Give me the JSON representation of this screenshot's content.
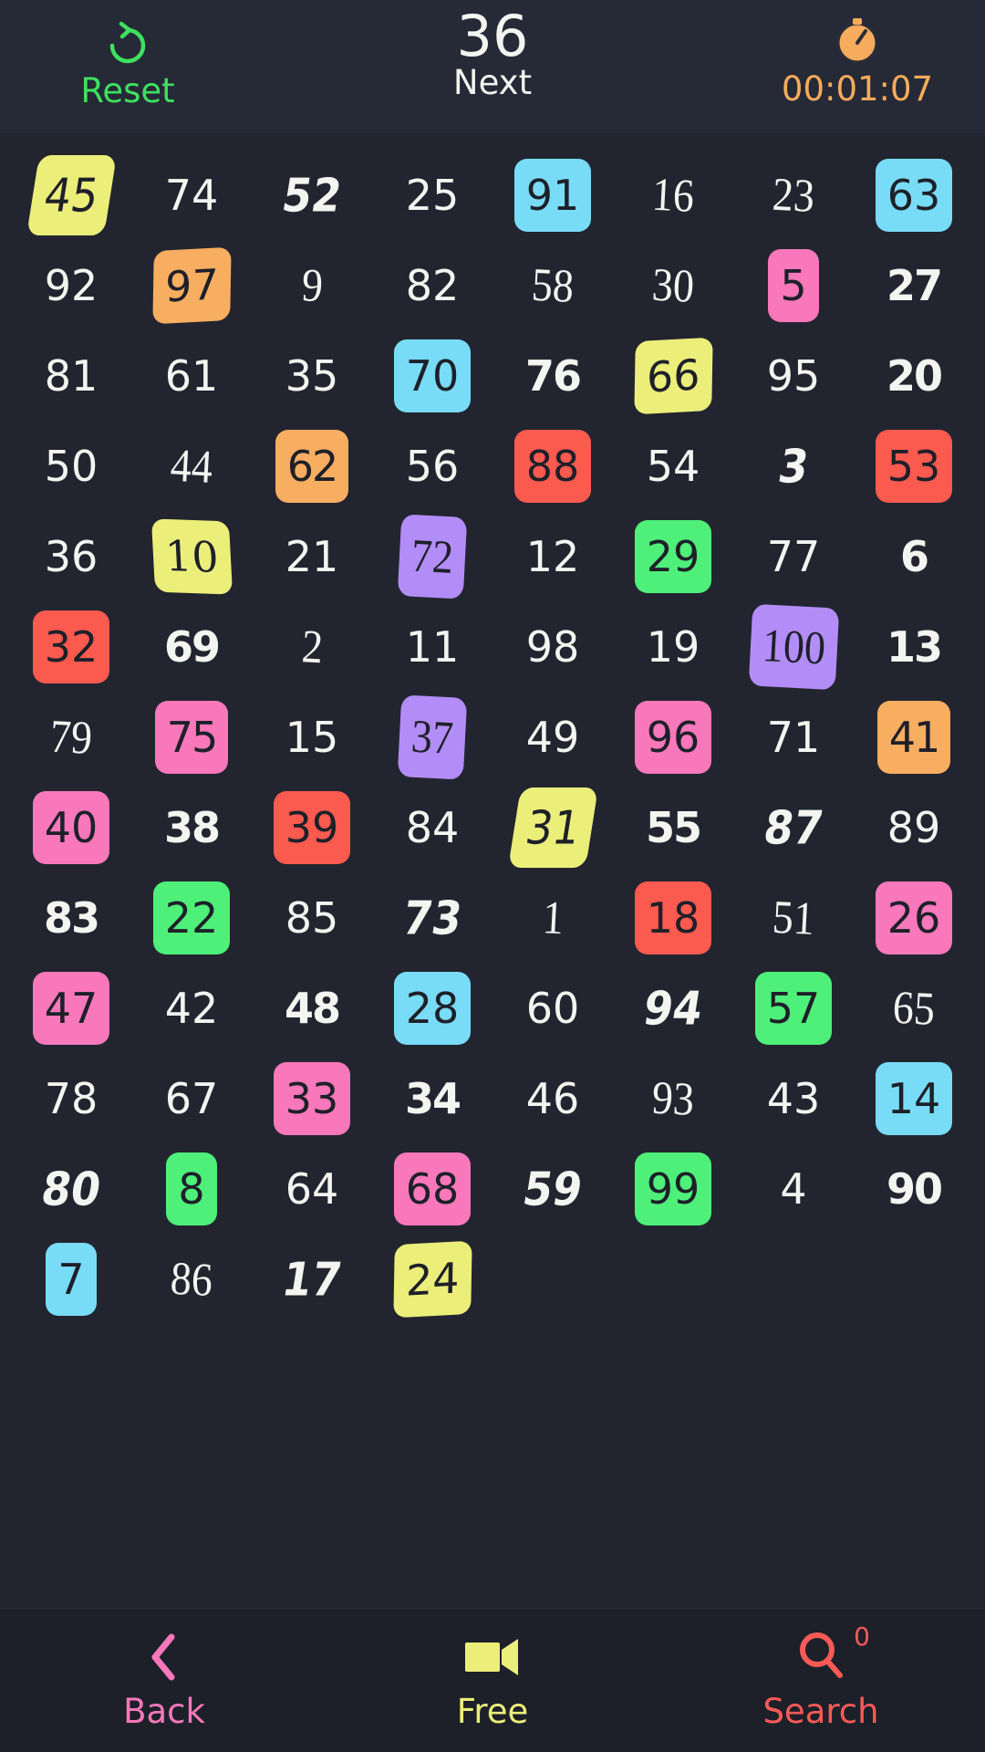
{
  "header": {
    "reset_label": "Reset",
    "reset_icon": "refresh-icon",
    "next_number": "36",
    "next_label": "Next",
    "timer_icon": "stopwatch-icon",
    "timer_text": "00:01:07",
    "colors": {
      "reset": "#3ee05f",
      "next": "#f4f4f0",
      "timer": "#f6ac5c",
      "bar_bg": "#262936"
    }
  },
  "board": {
    "background": "#22252f",
    "columns": 8,
    "palette": {
      "yellow": "#ecee7a",
      "cyan": "#79dcf7",
      "orange": "#f7ae61",
      "pink": "#f878bb",
      "red": "#fb5a4f",
      "green": "#4ef07a",
      "purple": "#b38df7",
      "plain": "transparent",
      "plain_text": "#f4f4f0",
      "highlight_text": "#1e2029"
    },
    "rows": [
      [
        {
          "value": "45",
          "color": "yellow",
          "style": "v3"
        },
        {
          "value": "74",
          "color": "plain",
          "style": "v0"
        },
        {
          "value": "52",
          "color": "plain",
          "style": "v3"
        },
        {
          "value": "25",
          "color": "plain",
          "style": "v0"
        },
        {
          "value": "91",
          "color": "cyan",
          "style": "v0"
        },
        {
          "value": "16",
          "color": "plain",
          "style": "v6"
        },
        {
          "value": "23",
          "color": "plain",
          "style": "v6"
        },
        {
          "value": "63",
          "color": "cyan",
          "style": "v0"
        }
      ],
      [
        {
          "value": "92",
          "color": "plain",
          "style": "v0"
        },
        {
          "value": "97",
          "color": "orange",
          "style": "v1"
        },
        {
          "value": "9",
          "color": "plain",
          "style": "v6"
        },
        {
          "value": "82",
          "color": "plain",
          "style": "v0"
        },
        {
          "value": "58",
          "color": "plain",
          "style": "v6"
        },
        {
          "value": "30",
          "color": "plain",
          "style": "v6"
        },
        {
          "value": "5",
          "color": "pink",
          "style": "v0"
        },
        {
          "value": "27",
          "color": "plain",
          "style": "v5"
        }
      ],
      [
        {
          "value": "81",
          "color": "plain",
          "style": "v0"
        },
        {
          "value": "61",
          "color": "plain",
          "style": "v0"
        },
        {
          "value": "35",
          "color": "plain",
          "style": "v0"
        },
        {
          "value": "70",
          "color": "cyan",
          "style": "v0"
        },
        {
          "value": "76",
          "color": "plain",
          "style": "v5"
        },
        {
          "value": "66",
          "color": "yellow",
          "style": "v1"
        },
        {
          "value": "95",
          "color": "plain",
          "style": "v0"
        },
        {
          "value": "20",
          "color": "plain",
          "style": "v5"
        }
      ],
      [
        {
          "value": "50",
          "color": "plain",
          "style": "v0"
        },
        {
          "value": "44",
          "color": "plain",
          "style": "v6"
        },
        {
          "value": "62",
          "color": "orange",
          "style": "v5"
        },
        {
          "value": "56",
          "color": "plain",
          "style": "v0"
        },
        {
          "value": "88",
          "color": "red",
          "style": "v0"
        },
        {
          "value": "54",
          "color": "plain",
          "style": "v0"
        },
        {
          "value": "3",
          "color": "plain",
          "style": "v3"
        },
        {
          "value": "53",
          "color": "red",
          "style": "v0"
        }
      ],
      [
        {
          "value": "36",
          "color": "plain",
          "style": "v0"
        },
        {
          "value": "10",
          "color": "yellow",
          "style": "v2"
        },
        {
          "value": "21",
          "color": "plain",
          "style": "v0"
        },
        {
          "value": "72",
          "color": "purple",
          "style": "v6"
        },
        {
          "value": "12",
          "color": "plain",
          "style": "v0"
        },
        {
          "value": "29",
          "color": "green",
          "style": "v0"
        },
        {
          "value": "77",
          "color": "plain",
          "style": "v0"
        },
        {
          "value": "6",
          "color": "plain",
          "style": "v5"
        }
      ],
      [
        {
          "value": "32",
          "color": "red",
          "style": "v0"
        },
        {
          "value": "69",
          "color": "plain",
          "style": "v5"
        },
        {
          "value": "2",
          "color": "plain",
          "style": "v6"
        },
        {
          "value": "11",
          "color": "plain",
          "style": "v0"
        },
        {
          "value": "98",
          "color": "plain",
          "style": "v0"
        },
        {
          "value": "19",
          "color": "plain",
          "style": "v0"
        },
        {
          "value": "100",
          "color": "purple",
          "style": "v6"
        },
        {
          "value": "13",
          "color": "plain",
          "style": "v5"
        }
      ],
      [
        {
          "value": "79",
          "color": "plain",
          "style": "v6"
        },
        {
          "value": "75",
          "color": "pink",
          "style": "v5"
        },
        {
          "value": "15",
          "color": "plain",
          "style": "v0"
        },
        {
          "value": "37",
          "color": "purple",
          "style": "v6"
        },
        {
          "value": "49",
          "color": "plain",
          "style": "v0"
        },
        {
          "value": "96",
          "color": "pink",
          "style": "v0"
        },
        {
          "value": "71",
          "color": "plain",
          "style": "v0"
        },
        {
          "value": "41",
          "color": "orange",
          "style": "v5"
        }
      ],
      [
        {
          "value": "40",
          "color": "pink",
          "style": "v0"
        },
        {
          "value": "38",
          "color": "plain",
          "style": "v5"
        },
        {
          "value": "39",
          "color": "red",
          "style": "v0"
        },
        {
          "value": "84",
          "color": "plain",
          "style": "v0"
        },
        {
          "value": "31",
          "color": "yellow",
          "style": "v3"
        },
        {
          "value": "55",
          "color": "plain",
          "style": "v5"
        },
        {
          "value": "87",
          "color": "plain",
          "style": "v3"
        },
        {
          "value": "89",
          "color": "plain",
          "style": "v0"
        }
      ],
      [
        {
          "value": "83",
          "color": "plain",
          "style": "v5"
        },
        {
          "value": "22",
          "color": "green",
          "style": "v0"
        },
        {
          "value": "85",
          "color": "plain",
          "style": "v0"
        },
        {
          "value": "73",
          "color": "plain",
          "style": "v3"
        },
        {
          "value": "1",
          "color": "plain",
          "style": "v6"
        },
        {
          "value": "18",
          "color": "red",
          "style": "v0"
        },
        {
          "value": "51",
          "color": "plain",
          "style": "v6"
        },
        {
          "value": "26",
          "color": "pink",
          "style": "v0"
        }
      ],
      [
        {
          "value": "47",
          "color": "pink",
          "style": "v0"
        },
        {
          "value": "42",
          "color": "plain",
          "style": "v0"
        },
        {
          "value": "48",
          "color": "plain",
          "style": "v5"
        },
        {
          "value": "28",
          "color": "cyan",
          "style": "v0"
        },
        {
          "value": "60",
          "color": "plain",
          "style": "v0"
        },
        {
          "value": "94",
          "color": "plain",
          "style": "v3"
        },
        {
          "value": "57",
          "color": "green",
          "style": "v0"
        },
        {
          "value": "65",
          "color": "plain",
          "style": "v6"
        }
      ],
      [
        {
          "value": "78",
          "color": "plain",
          "style": "v0"
        },
        {
          "value": "67",
          "color": "plain",
          "style": "v0"
        },
        {
          "value": "33",
          "color": "pink",
          "style": "v0"
        },
        {
          "value": "34",
          "color": "plain",
          "style": "v5"
        },
        {
          "value": "46",
          "color": "plain",
          "style": "v0"
        },
        {
          "value": "93",
          "color": "plain",
          "style": "v6"
        },
        {
          "value": "43",
          "color": "plain",
          "style": "v0"
        },
        {
          "value": "14",
          "color": "cyan",
          "style": "v0"
        }
      ],
      [
        {
          "value": "80",
          "color": "plain",
          "style": "v3"
        },
        {
          "value": "8",
          "color": "green",
          "style": "v0"
        },
        {
          "value": "64",
          "color": "plain",
          "style": "v0"
        },
        {
          "value": "68",
          "color": "pink",
          "style": "v0"
        },
        {
          "value": "59",
          "color": "plain",
          "style": "v3"
        },
        {
          "value": "99",
          "color": "green",
          "style": "v0"
        },
        {
          "value": "4",
          "color": "plain",
          "style": "v0"
        },
        {
          "value": "90",
          "color": "plain",
          "style": "v5"
        }
      ],
      [
        {
          "value": "7",
          "color": "cyan",
          "style": "v0"
        },
        {
          "value": "86",
          "color": "plain",
          "style": "v6"
        },
        {
          "value": "17",
          "color": "plain",
          "style": "v3"
        },
        {
          "value": "24",
          "color": "yellow",
          "style": "v1"
        }
      ]
    ]
  },
  "bottom_bar": {
    "back": {
      "label": "Back",
      "icon": "chevron-left-icon",
      "color": "#f878bb"
    },
    "free": {
      "label": "Free",
      "icon": "video-camera-icon",
      "color": "#ecee7a"
    },
    "search": {
      "label": "Search",
      "icon": "magnifier-icon",
      "badge": "0",
      "color": "#fb5a57"
    }
  }
}
